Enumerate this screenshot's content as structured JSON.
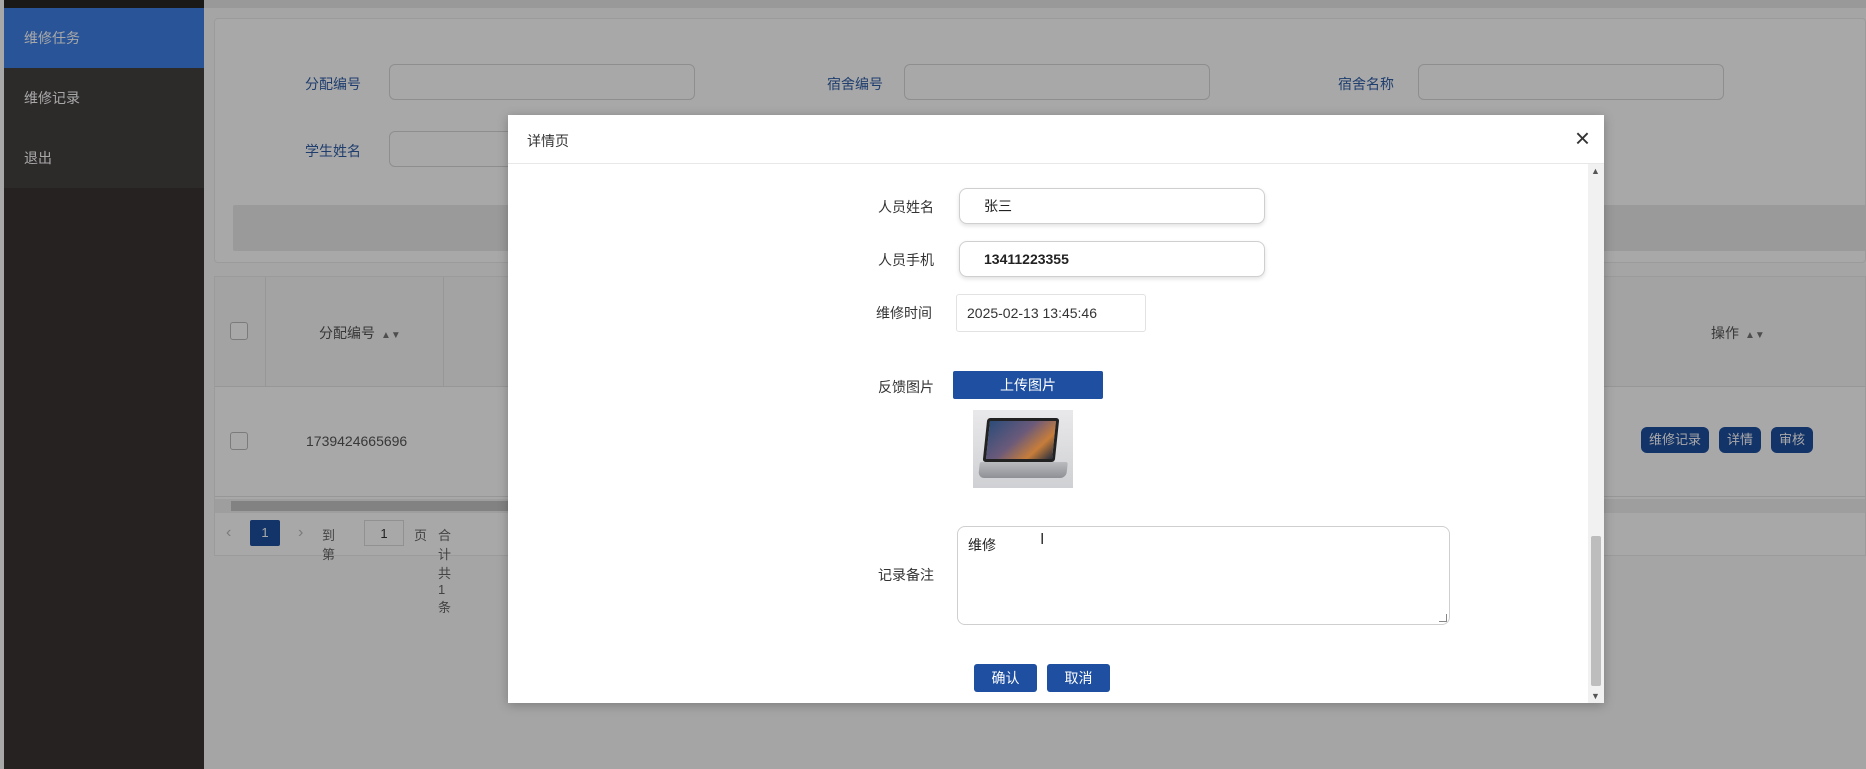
{
  "sidebar": {
    "items": [
      {
        "label": "维修任务"
      },
      {
        "label": "维修记录"
      },
      {
        "label": "退出"
      }
    ]
  },
  "search": {
    "fields": [
      {
        "label": "分配编号"
      },
      {
        "label": "宿舍编号"
      },
      {
        "label": "宿舍名称"
      },
      {
        "label": "学生姓名"
      }
    ]
  },
  "table": {
    "columns": [
      "分配编号",
      "操作"
    ],
    "rows": [
      {
        "id": "1739424665696"
      }
    ],
    "actions": [
      "维修记录",
      "详情",
      "审核"
    ]
  },
  "pager": {
    "current": "1",
    "goto_label": "到第",
    "goto_value": "1",
    "page_label": "页",
    "total_text": "合计共 1 条"
  },
  "modal": {
    "title": "详情页",
    "fields": {
      "name_label": "人员姓名",
      "name_value": "张三",
      "phone_label": "人员手机",
      "phone_value": "13411223355",
      "time_label": "维修时间",
      "time_value": "2025-02-13 13:45:46",
      "image_label": "反馈图片",
      "upload_label": "上传图片",
      "remark_label": "记录备注",
      "remark_value": "维修"
    },
    "confirm_label": "确认",
    "cancel_label": "取消"
  },
  "colors": {
    "primary": "#1e4fa0",
    "sidebar_active": "#3f80e6",
    "sidebar_bg": "#3a3533"
  }
}
